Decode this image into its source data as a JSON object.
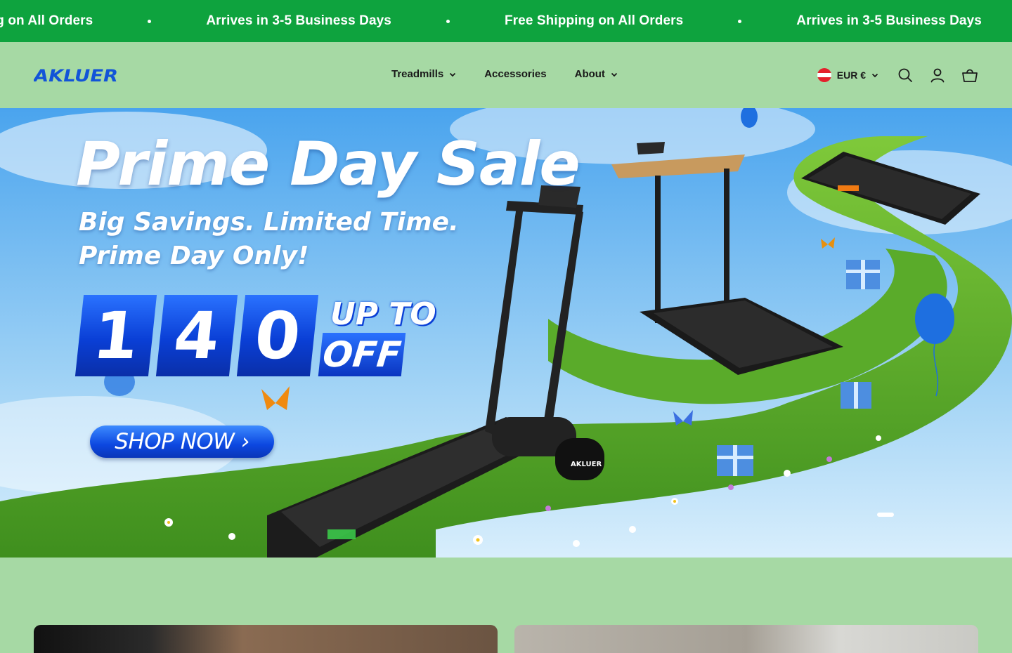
{
  "announcement": {
    "items": [
      "Free Shipping on All Orders",
      "Arrives in 3-5 Business Days",
      "Free Shipping on All Orders",
      "Arrives in 3-5 Business Days"
    ]
  },
  "header": {
    "logo_text": "AKLUER",
    "nav": [
      {
        "label": "Treadmills",
        "has_dropdown": true
      },
      {
        "label": "Accessories",
        "has_dropdown": false
      },
      {
        "label": "About",
        "has_dropdown": true
      }
    ],
    "currency": "EUR €",
    "icons": [
      "search-icon",
      "account-icon",
      "cart-icon"
    ]
  },
  "hero": {
    "title": "Prime Day Sale",
    "subtitle_1": "Big Savings. Limited Time.",
    "subtitle_2": "Prime Day Only!",
    "digits": [
      "1",
      "4",
      "0"
    ],
    "up_to": "UP TO",
    "off": "OFF",
    "cta": "SHOP NOW ›",
    "product_logo": "AKLUER",
    "active_slide": 1
  },
  "colors": {
    "announcement_bg": "#0ea33e",
    "page_bg": "#a6d9a4",
    "brand_blue": "#0a3fd6"
  }
}
